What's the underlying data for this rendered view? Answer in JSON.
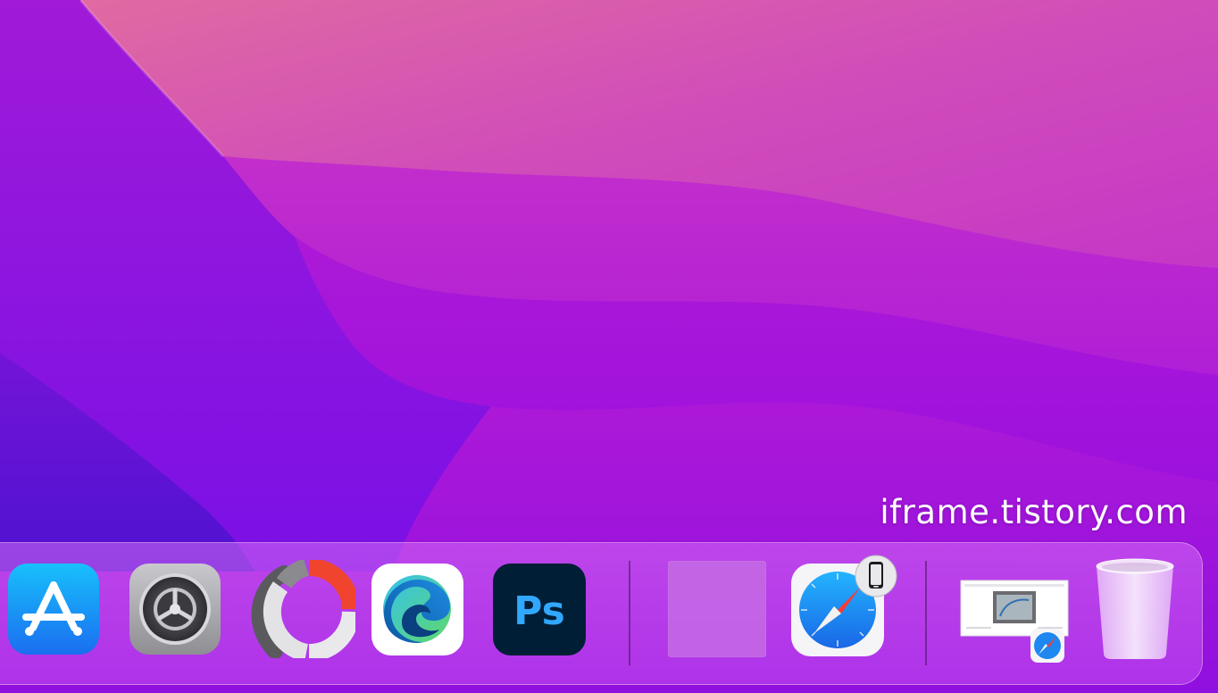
{
  "desktop": {
    "watermark_text": "iframe.tistory.com",
    "wallpaper": "macOS Monterey purple"
  },
  "dock": {
    "items": [
      {
        "name": "App Store",
        "icon": "app-store-icon"
      },
      {
        "name": "System Preferences",
        "icon": "system-preferences-icon"
      },
      {
        "name": "Color picker app",
        "icon": "color-wheel-icon"
      },
      {
        "name": "Microsoft Edge",
        "icon": "edge-icon"
      },
      {
        "name": "Adobe Photoshop",
        "icon": "photoshop-icon",
        "label": "Ps"
      },
      {
        "name": "Blank app",
        "icon": "blank-app-icon"
      },
      {
        "name": "Safari",
        "icon": "safari-icon",
        "badge": "iphone-handoff-badge"
      },
      {
        "name": "Web document",
        "icon": "web-document-icon",
        "badge": "safari-badge"
      },
      {
        "name": "Trash",
        "icon": "trash-icon"
      }
    ]
  },
  "colors": {
    "wallpaper_top": "#d64fb0",
    "wallpaper_mid": "#b21ad6",
    "wallpaper_bottom": "#6a10e0",
    "dock_tint": "#c955f0",
    "photoshop_bg": "#001e36",
    "photoshop_text": "#31a8ff",
    "app_store_blue": "#1c7ef0",
    "safari_blue": "#1e87f0"
  }
}
